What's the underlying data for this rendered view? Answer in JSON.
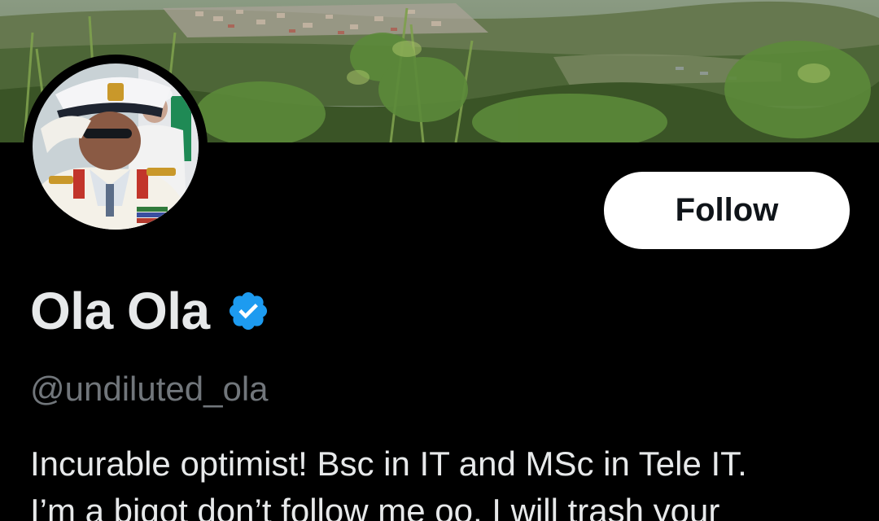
{
  "header": {
    "banner_image": "hillside-landscape-photo",
    "avatar_image": "profile-photo-saluting-officer"
  },
  "actions": {
    "follow_label": "Follow"
  },
  "profile": {
    "display_name": "Ola Ola",
    "verified_icon": "verified-badge-icon",
    "handle": "@undiluted_ola",
    "bio_lines": [
      "Incurable optimist! Bsc in IT and MSc in Tele IT.",
      "I’m a bigot don’t follow me oo. I will trash your"
    ]
  },
  "colors": {
    "background": "#000000",
    "text_primary": "#e7e9ea",
    "text_secondary": "#71767b",
    "verified_blue": "#1d9bf0",
    "button_bg": "#ffffff",
    "button_text": "#0f1419"
  }
}
